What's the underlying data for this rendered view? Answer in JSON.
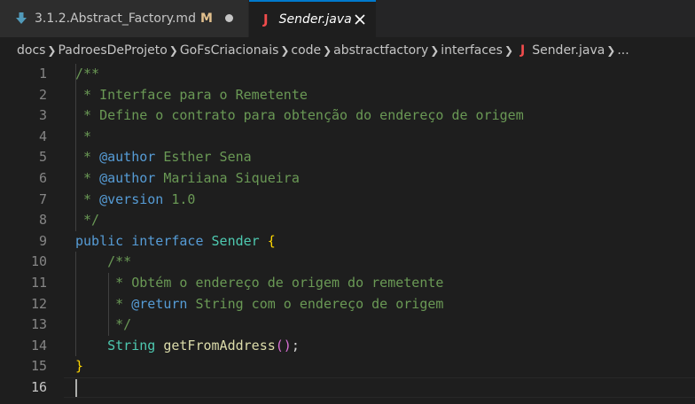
{
  "tabs": [
    {
      "label": "3.1.2.Abstract_Factory.md",
      "badge": "M",
      "dirty": true,
      "active": false,
      "icon": "markdown-download-icon"
    },
    {
      "label": "Sender.java",
      "active": true,
      "icon": "java-icon",
      "icon_glyph": "J"
    }
  ],
  "breadcrumb": [
    "docs",
    "PadroesDeProjeto",
    "GoFsCriacionais",
    "code",
    "abstractfactory",
    "interfaces",
    "Sender.java",
    "..."
  ],
  "breadcrumb_icon_glyph": "J",
  "editor": {
    "current_line": 16,
    "lines": [
      {
        "n": "1",
        "tokens": [
          {
            "t": "/**",
            "c": "comment"
          }
        ]
      },
      {
        "n": "2",
        "tokens": [
          {
            "t": " * Interface para o Remetente",
            "c": "comment"
          }
        ]
      },
      {
        "n": "3",
        "tokens": [
          {
            "t": " * Define o contrato para obtenção do endereço de origem",
            "c": "comment"
          }
        ]
      },
      {
        "n": "4",
        "tokens": [
          {
            "t": " *",
            "c": "comment"
          }
        ]
      },
      {
        "n": "5",
        "tokens": [
          {
            "t": " * ",
            "c": "comment"
          },
          {
            "t": "@author",
            "c": "tag"
          },
          {
            "t": " Esther Sena",
            "c": "comment"
          }
        ]
      },
      {
        "n": "6",
        "tokens": [
          {
            "t": " * ",
            "c": "comment"
          },
          {
            "t": "@author",
            "c": "tag"
          },
          {
            "t": " Mariiana Siqueira",
            "c": "comment"
          }
        ]
      },
      {
        "n": "7",
        "tokens": [
          {
            "t": " * ",
            "c": "comment"
          },
          {
            "t": "@version",
            "c": "tag"
          },
          {
            "t": " 1.0",
            "c": "comment"
          }
        ]
      },
      {
        "n": "8",
        "tokens": [
          {
            "t": " */",
            "c": "comment"
          }
        ]
      },
      {
        "n": "9",
        "tokens": [
          {
            "t": "public",
            "c": "kw"
          },
          {
            "t": " ",
            "c": "plain"
          },
          {
            "t": "interface",
            "c": "kw"
          },
          {
            "t": " ",
            "c": "plain"
          },
          {
            "t": "Sender",
            "c": "type"
          },
          {
            "t": " ",
            "c": "plain"
          },
          {
            "t": "{",
            "c": "brace"
          }
        ]
      },
      {
        "n": "10",
        "tokens": [
          {
            "t": "    /**",
            "c": "comment"
          }
        ]
      },
      {
        "n": "11",
        "tokens": [
          {
            "t": "     * Obtém o endereço de origem do remetente",
            "c": "comment"
          }
        ]
      },
      {
        "n": "12",
        "tokens": [
          {
            "t": "     * ",
            "c": "comment"
          },
          {
            "t": "@return",
            "c": "tag"
          },
          {
            "t": " String com o endereço de origem",
            "c": "comment"
          }
        ]
      },
      {
        "n": "13",
        "tokens": [
          {
            "t": "     */",
            "c": "comment"
          }
        ]
      },
      {
        "n": "14",
        "tokens": [
          {
            "t": "    ",
            "c": "plain"
          },
          {
            "t": "String",
            "c": "type"
          },
          {
            "t": " ",
            "c": "plain"
          },
          {
            "t": "getFromAddress",
            "c": "fn"
          },
          {
            "t": "()",
            "c": "paren"
          },
          {
            "t": ";",
            "c": "plain"
          }
        ]
      },
      {
        "n": "15",
        "tokens": [
          {
            "t": "}",
            "c": "brace"
          }
        ]
      },
      {
        "n": "16",
        "tokens": []
      }
    ]
  },
  "colors": {
    "background": "#1e1e1e",
    "tabbar": "#252526",
    "active_tab_border": "#007acc",
    "comment": "#6a9955",
    "keyword": "#569cd6",
    "type": "#4ec9b0",
    "function": "#dcdcaa",
    "brace": "#ffd700",
    "paren": "#da70d6",
    "java_icon": "#f14c4c",
    "modified_badge": "#e2c08d"
  }
}
